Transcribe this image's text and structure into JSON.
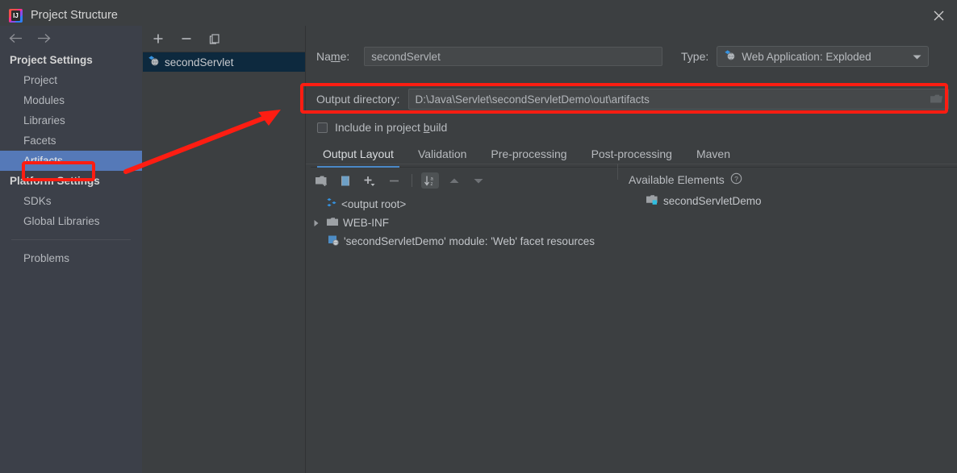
{
  "window": {
    "title": "Project Structure",
    "app_icon": "intellij-idea-icon",
    "close_icon": "close-icon"
  },
  "sidebar": {
    "nav": {
      "back_icon": "arrow-left-icon",
      "forward_icon": "arrow-right-icon"
    },
    "groups": [
      {
        "label": "Project Settings",
        "items": [
          {
            "label": "Project",
            "selected": false
          },
          {
            "label": "Modules",
            "selected": false
          },
          {
            "label": "Libraries",
            "selected": false
          },
          {
            "label": "Facets",
            "selected": false
          },
          {
            "label": "Artifacts",
            "selected": true
          }
        ]
      },
      {
        "label": "Platform Settings",
        "items": [
          {
            "label": "SDKs",
            "selected": false
          },
          {
            "label": "Global Libraries",
            "selected": false
          }
        ]
      }
    ],
    "problems": {
      "label": "Problems"
    }
  },
  "artifacts_panel": {
    "toolbar": [
      {
        "name": "add-artifact-button",
        "glyph": "+"
      },
      {
        "name": "remove-artifact-button",
        "glyph": "−"
      },
      {
        "name": "copy-artifact-button",
        "glyph": "copy-icon"
      }
    ],
    "items": [
      {
        "label": "secondServlet",
        "icon": "web-application-exploded-icon",
        "selected": true
      }
    ]
  },
  "main": {
    "name_field": {
      "label_before": "Na",
      "label_mnemonic": "m",
      "label_after": "e:",
      "value": "secondServlet"
    },
    "type_field": {
      "label": "Type:",
      "value": "Web Application: Exploded",
      "icon": "web-application-exploded-icon",
      "caret_icon": "chevron-down-icon"
    },
    "output_directory": {
      "label": "Output directory:",
      "value": "D:\\Java\\Servlet\\secondServletDemo\\out\\artifacts",
      "browse_icon": "folder-icon"
    },
    "include_checkbox": {
      "label_before": "Include in project ",
      "label_mnemonic": "b",
      "label_after": "uild",
      "checked": false
    },
    "tabs": [
      {
        "label": "Output Layout",
        "active": true
      },
      {
        "label": "Validation",
        "active": false
      },
      {
        "label": "Pre-processing",
        "active": false
      },
      {
        "label": "Post-processing",
        "active": false
      },
      {
        "label": "Maven",
        "active": false
      }
    ],
    "layout_toolbar": [
      {
        "name": "create-directory-button",
        "icon": "new-folder-icon",
        "active": false
      },
      {
        "name": "create-archive-button",
        "icon": "archive-icon",
        "active": false
      },
      {
        "name": "add-copy-button",
        "icon": "add-dropdown-icon",
        "active": false
      },
      {
        "name": "remove-element-button",
        "icon": "minus-icon",
        "active": false
      },
      {
        "name": "sort-button",
        "icon": "sort-alphabetical-icon",
        "active": true
      },
      {
        "name": "move-up-button",
        "icon": "arrow-up-icon",
        "active": false
      },
      {
        "name": "move-down-button",
        "icon": "arrow-down-icon",
        "active": false
      }
    ],
    "output_tree": [
      {
        "label": "<output root>",
        "icon": "artifact-root-icon",
        "expander": "none",
        "indent": 0
      },
      {
        "label": "WEB-INF",
        "icon": "folder-icon",
        "expander": "collapsed",
        "indent": 0
      },
      {
        "label": "'secondServletDemo' module: 'Web' facet resources",
        "icon": "web-facet-icon",
        "expander": "none",
        "indent": 1
      }
    ],
    "available_elements": {
      "title": "Available Elements",
      "help_icon": "help-icon",
      "items": [
        {
          "label": "secondServletDemo",
          "icon": "module-icon"
        }
      ]
    }
  },
  "annotations": {
    "accent_color": "#fd1d12",
    "highlight_artifacts": "Artifacts",
    "highlight_output_directory": "Output directory:"
  },
  "colors": {
    "window_bg": "#3c3f41",
    "sidebar_bg": "#3c4049",
    "selection_blue": "#5579b8",
    "list_selection": "#0d293e",
    "tab_underline": "#4a88c7",
    "annotation_red": "#fd1d12"
  }
}
